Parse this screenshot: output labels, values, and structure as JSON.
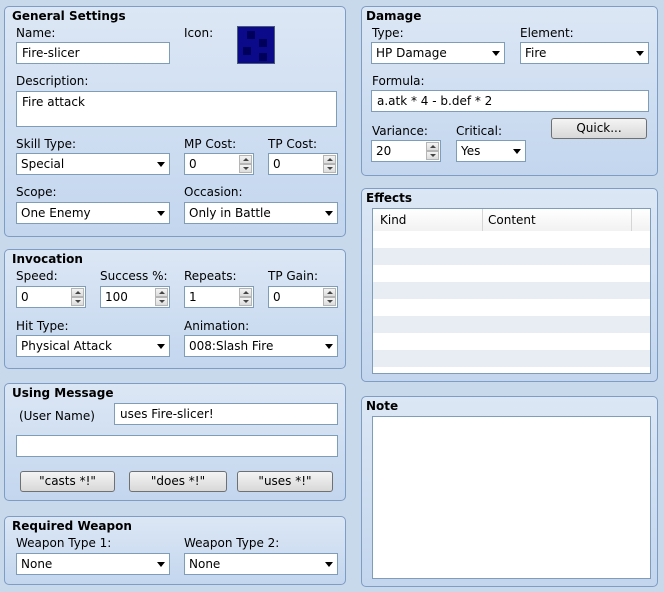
{
  "general": {
    "title": "General Settings",
    "name_label": "Name:",
    "name_value": "Fire-slicer",
    "icon_label": "Icon:",
    "description_label": "Description:",
    "description_value": "Fire attack",
    "skill_type_label": "Skill Type:",
    "skill_type_value": "Special",
    "mp_cost_label": "MP Cost:",
    "mp_cost_value": "0",
    "tp_cost_label": "TP Cost:",
    "tp_cost_value": "0",
    "scope_label": "Scope:",
    "scope_value": "One Enemy",
    "occasion_label": "Occasion:",
    "occasion_value": "Only in Battle"
  },
  "invocation": {
    "title": "Invocation",
    "speed_label": "Speed:",
    "speed_value": "0",
    "success_label": "Success %:",
    "success_value": "100",
    "repeats_label": "Repeats:",
    "repeats_value": "1",
    "tp_gain_label": "TP Gain:",
    "tp_gain_value": "0",
    "hit_type_label": "Hit Type:",
    "hit_type_value": "Physical Attack",
    "animation_label": "Animation:",
    "animation_value": "008:Slash Fire"
  },
  "message": {
    "title": "Using Message",
    "user_name_label": "(User Name)",
    "line1_value": "uses Fire-slicer!",
    "line2_value": "",
    "casts_label": "\"casts *!\"",
    "does_label": "\"does *!\"",
    "uses_label": "\"uses *!\""
  },
  "weapon": {
    "title": "Required Weapon",
    "type1_label": "Weapon Type 1:",
    "type1_value": "None",
    "type2_label": "Weapon Type 2:",
    "type2_value": "None"
  },
  "damage": {
    "title": "Damage",
    "type_label": "Type:",
    "type_value": "HP Damage",
    "element_label": "Element:",
    "element_value": "Fire",
    "formula_label": "Formula:",
    "formula_value": "a.atk * 4 - b.def * 2",
    "variance_label": "Variance:",
    "variance_value": "20",
    "critical_label": "Critical:",
    "critical_value": "Yes",
    "quick_label": "Quick..."
  },
  "effects": {
    "title": "Effects",
    "columns": [
      "Kind",
      "Content"
    ]
  },
  "note": {
    "title": "Note",
    "value": ""
  },
  "colors": {
    "panel_border": "#7e9cc4",
    "background": "#c9d9ec",
    "icon_fill": "#0a0a8a"
  }
}
